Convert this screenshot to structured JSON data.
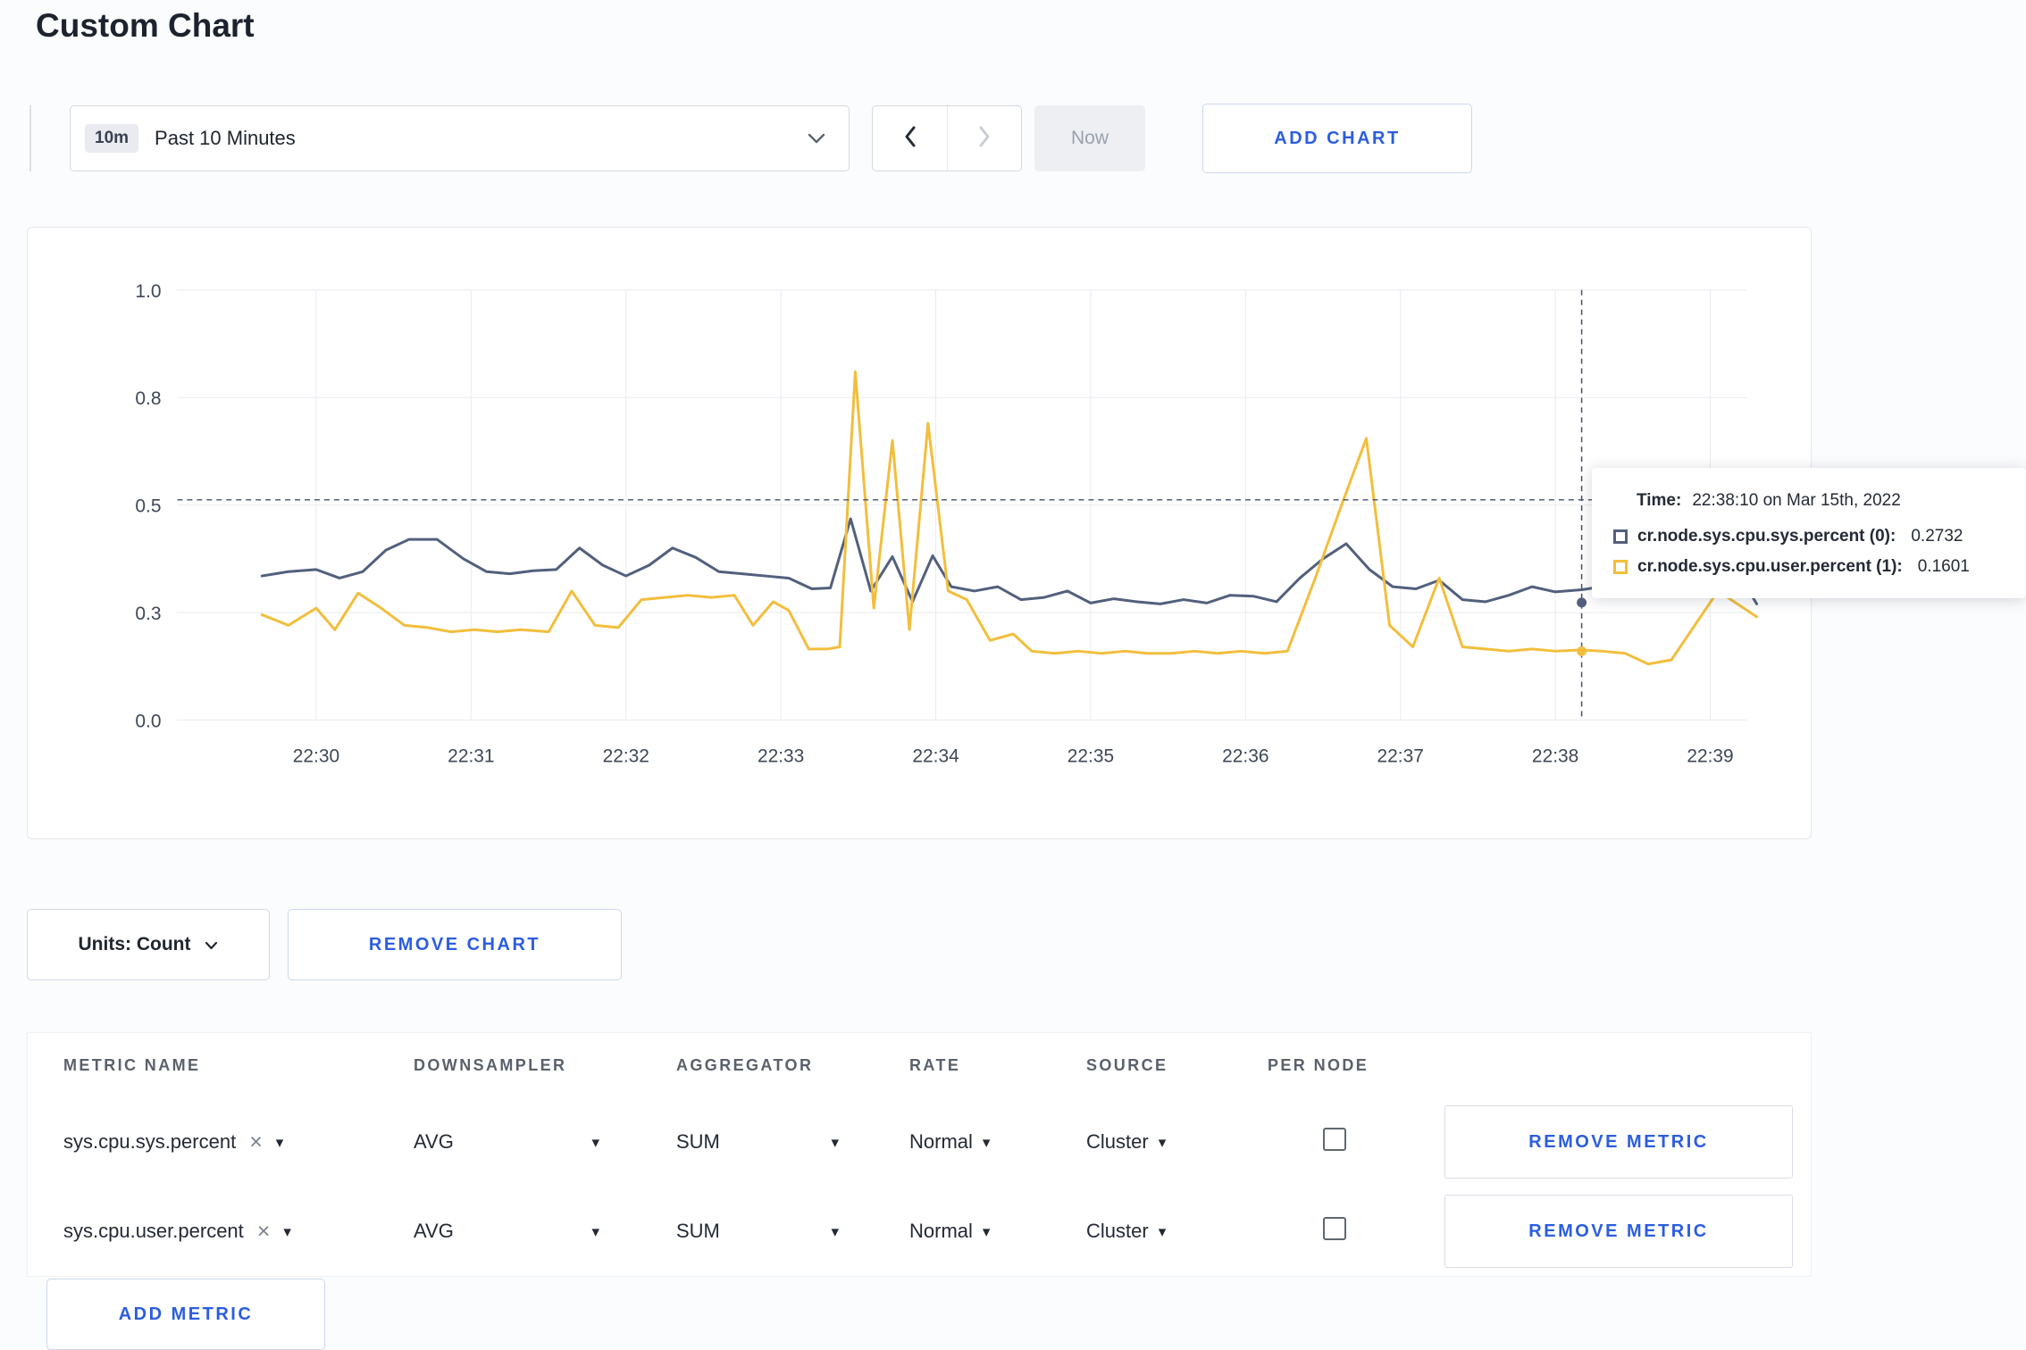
{
  "page": {
    "title": "Custom Chart"
  },
  "icons": {
    "caret_down": "▾",
    "close": "×"
  },
  "toolbar": {
    "time_badge": "10m",
    "time_label": "Past 10 Minutes",
    "now_label": "Now",
    "add_chart_label": "ADD CHART"
  },
  "tooltip": {
    "time_label": "Time:",
    "time_value": "22:38:10 on Mar 15th, 2022",
    "rows": [
      {
        "label": "cr.node.sys.cpu.sys.percent (0):",
        "value": "0.2732"
      },
      {
        "label": "cr.node.sys.cpu.user.percent (1):",
        "value": "0.1601"
      }
    ]
  },
  "chart_controls": {
    "units_label": "Units: Count",
    "remove_chart_label": "REMOVE CHART"
  },
  "metrics_table": {
    "headers": [
      "METRIC NAME",
      "DOWNSAMPLER",
      "AGGREGATOR",
      "RATE",
      "SOURCE",
      "PER NODE"
    ],
    "rows": [
      {
        "metric": "sys.cpu.sys.percent",
        "downsampler": "AVG",
        "aggregator": "SUM",
        "rate": "Normal",
        "source": "Cluster",
        "per_node_checked": false,
        "remove_label": "REMOVE METRIC"
      },
      {
        "metric": "sys.cpu.user.percent",
        "downsampler": "AVG",
        "aggregator": "SUM",
        "rate": "Normal",
        "source": "Cluster",
        "per_node_checked": false,
        "remove_label": "REMOVE METRIC"
      }
    ],
    "add_metric_label": "ADD METRIC"
  },
  "chart_data": {
    "type": "line",
    "title": "",
    "x_ticks": [
      "22:30",
      "22:31",
      "22:32",
      "22:33",
      "22:34",
      "22:35",
      "22:36",
      "22:37",
      "22:38",
      "22:39"
    ],
    "y_ticks": {
      "values": [
        0,
        0.25,
        0.5,
        0.75,
        1.0
      ],
      "labels": [
        "0.0",
        "0.3",
        "0.5",
        "0.8",
        "1.0"
      ]
    },
    "ylim": [
      0,
      1
    ],
    "grid": true,
    "colors": {
      "grid": "#e9ebf0",
      "crosshair": "#44506a",
      "tick_text": "#3f4755"
    },
    "series": [
      {
        "name": "cr.node.sys.cpu.sys.percent",
        "color": "#52607d",
        "points": [
          [
            -0.35,
            0.335
          ],
          [
            -0.18,
            0.345
          ],
          [
            0,
            0.35
          ],
          [
            0.15,
            0.33
          ],
          [
            0.3,
            0.345
          ],
          [
            0.45,
            0.395
          ],
          [
            0.6,
            0.42
          ],
          [
            0.78,
            0.42
          ],
          [
            0.95,
            0.375
          ],
          [
            1.1,
            0.345
          ],
          [
            1.25,
            0.34
          ],
          [
            1.4,
            0.347
          ],
          [
            1.55,
            0.35
          ],
          [
            1.7,
            0.4
          ],
          [
            1.85,
            0.36
          ],
          [
            2.0,
            0.335
          ],
          [
            2.15,
            0.36
          ],
          [
            2.3,
            0.4
          ],
          [
            2.45,
            0.378
          ],
          [
            2.6,
            0.345
          ],
          [
            2.75,
            0.34
          ],
          [
            2.9,
            0.335
          ],
          [
            3.05,
            0.33
          ],
          [
            3.2,
            0.305
          ],
          [
            3.32,
            0.307
          ],
          [
            3.45,
            0.468
          ],
          [
            3.58,
            0.3
          ],
          [
            3.72,
            0.38
          ],
          [
            3.85,
            0.275
          ],
          [
            3.98,
            0.382
          ],
          [
            4.1,
            0.31
          ],
          [
            4.25,
            0.3
          ],
          [
            4.4,
            0.31
          ],
          [
            4.55,
            0.28
          ],
          [
            4.7,
            0.285
          ],
          [
            4.85,
            0.3
          ],
          [
            5.0,
            0.272
          ],
          [
            5.15,
            0.282
          ],
          [
            5.3,
            0.275
          ],
          [
            5.45,
            0.27
          ],
          [
            5.6,
            0.28
          ],
          [
            5.75,
            0.272
          ],
          [
            5.9,
            0.29
          ],
          [
            6.05,
            0.288
          ],
          [
            6.2,
            0.275
          ],
          [
            6.35,
            0.33
          ],
          [
            6.5,
            0.375
          ],
          [
            6.65,
            0.41
          ],
          [
            6.8,
            0.35
          ],
          [
            6.95,
            0.31
          ],
          [
            7.1,
            0.305
          ],
          [
            7.25,
            0.325
          ],
          [
            7.4,
            0.28
          ],
          [
            7.55,
            0.275
          ],
          [
            7.7,
            0.29
          ],
          [
            7.85,
            0.31
          ],
          [
            8.0,
            0.298
          ],
          [
            8.17,
            0.303
          ],
          [
            8.3,
            0.31
          ],
          [
            8.45,
            0.298
          ],
          [
            8.6,
            0.295
          ],
          [
            8.75,
            0.31
          ],
          [
            8.9,
            0.3
          ],
          [
            9.05,
            0.3
          ],
          [
            9.2,
            0.33
          ],
          [
            9.3,
            0.27
          ]
        ]
      },
      {
        "name": "cr.node.sys.cpu.user.percent",
        "color": "#f2be3c",
        "points": [
          [
            -0.35,
            0.245
          ],
          [
            -0.18,
            0.22
          ],
          [
            0,
            0.26
          ],
          [
            0.12,
            0.21
          ],
          [
            0.27,
            0.295
          ],
          [
            0.42,
            0.26
          ],
          [
            0.57,
            0.22
          ],
          [
            0.72,
            0.215
          ],
          [
            0.87,
            0.205
          ],
          [
            1.02,
            0.21
          ],
          [
            1.17,
            0.205
          ],
          [
            1.32,
            0.21
          ],
          [
            1.5,
            0.205
          ],
          [
            1.65,
            0.3
          ],
          [
            1.8,
            0.22
          ],
          [
            1.95,
            0.215
          ],
          [
            2.1,
            0.28
          ],
          [
            2.25,
            0.285
          ],
          [
            2.4,
            0.29
          ],
          [
            2.55,
            0.285
          ],
          [
            2.7,
            0.29
          ],
          [
            2.82,
            0.22
          ],
          [
            2.95,
            0.275
          ],
          [
            3.05,
            0.255
          ],
          [
            3.18,
            0.165
          ],
          [
            3.3,
            0.165
          ],
          [
            3.38,
            0.17
          ],
          [
            3.48,
            0.81
          ],
          [
            3.6,
            0.26
          ],
          [
            3.72,
            0.65
          ],
          [
            3.83,
            0.21
          ],
          [
            3.95,
            0.69
          ],
          [
            4.08,
            0.3
          ],
          [
            4.2,
            0.28
          ],
          [
            4.35,
            0.185
          ],
          [
            4.5,
            0.2
          ],
          [
            4.62,
            0.16
          ],
          [
            4.77,
            0.155
          ],
          [
            4.92,
            0.16
          ],
          [
            5.07,
            0.155
          ],
          [
            5.22,
            0.16
          ],
          [
            5.37,
            0.155
          ],
          [
            5.52,
            0.155
          ],
          [
            5.67,
            0.16
          ],
          [
            5.82,
            0.155
          ],
          [
            5.97,
            0.16
          ],
          [
            6.12,
            0.155
          ],
          [
            6.27,
            0.16
          ],
          [
            6.45,
            0.33
          ],
          [
            6.62,
            0.5
          ],
          [
            6.78,
            0.655
          ],
          [
            6.93,
            0.22
          ],
          [
            7.08,
            0.17
          ],
          [
            7.25,
            0.33
          ],
          [
            7.4,
            0.17
          ],
          [
            7.55,
            0.165
          ],
          [
            7.7,
            0.16
          ],
          [
            7.85,
            0.165
          ],
          [
            8.0,
            0.16
          ],
          [
            8.17,
            0.163
          ],
          [
            8.3,
            0.16
          ],
          [
            8.45,
            0.155
          ],
          [
            8.6,
            0.13
          ],
          [
            8.75,
            0.14
          ],
          [
            8.9,
            0.22
          ],
          [
            9.05,
            0.3
          ],
          [
            9.3,
            0.24
          ]
        ]
      }
    ],
    "crosshair": {
      "x_minutes": 8.17,
      "hline_value": 0.512,
      "dots": [
        {
          "series": 0,
          "value": 0.273
        },
        {
          "series": 1,
          "value": 0.16
        }
      ]
    }
  }
}
